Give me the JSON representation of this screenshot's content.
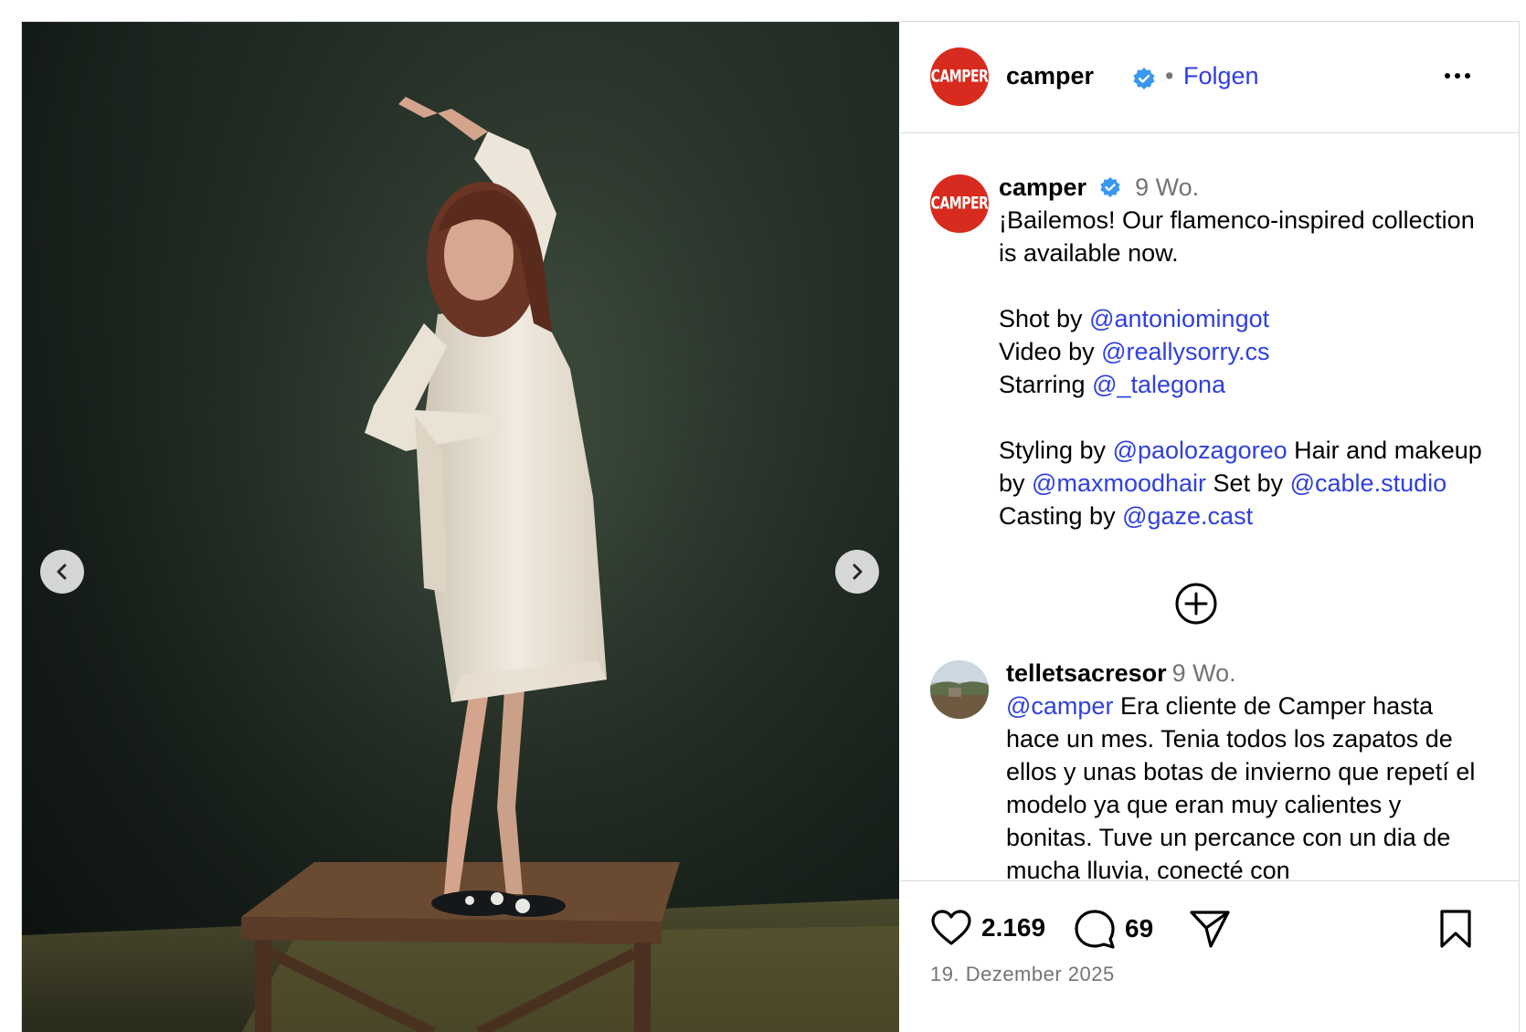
{
  "post": {
    "account": "camper",
    "logo_text": "CAMPER",
    "follow_label": "Folgen",
    "separator": "•",
    "more_icon": "more-horizontal-icon",
    "verified_color": "#3897f0",
    "brand_color": "#d62b1e",
    "link_color": "#3040dc"
  },
  "caption": {
    "username": "camper",
    "time": "9 Wo.",
    "line1": "¡Bailemos! Our flamenco-inspired collection is available now.",
    "shot_by_label": "Shot by",
    "shot_by": "@antoniomingot",
    "video_by_label": "Video by",
    "video_by": "@reallysorry.cs",
    "starring_label": "Starring",
    "starring": "@_talegona",
    "styling_label": "Styling by",
    "styling": "@paolozagoreo",
    "hair_label": "Hair and makeup by",
    "hair": "@maxmoodhair",
    "set_label": "Set by",
    "set": "@cable.studio",
    "casting_label": "Casting by",
    "casting": "@gaze.cast"
  },
  "load_more_icon": "plus-circle-icon",
  "comment": {
    "username": "telletsacresor",
    "time": "9 Wo.",
    "mention": "@camper",
    "text": "Era cliente de Camper hasta hace un mes. Tenia todos los zapatos de ellos y unas botas de invierno que repetí el modelo ya que eran muy calientes y bonitas. Tuve un percance con un dia de mucha lluvia, conecté con"
  },
  "actions": {
    "likes": "2.169",
    "comments": "69",
    "date": "19. Dezember 2025"
  },
  "media": {
    "prev_icon": "chevron-left-icon",
    "next_icon": "chevron-right-icon"
  }
}
